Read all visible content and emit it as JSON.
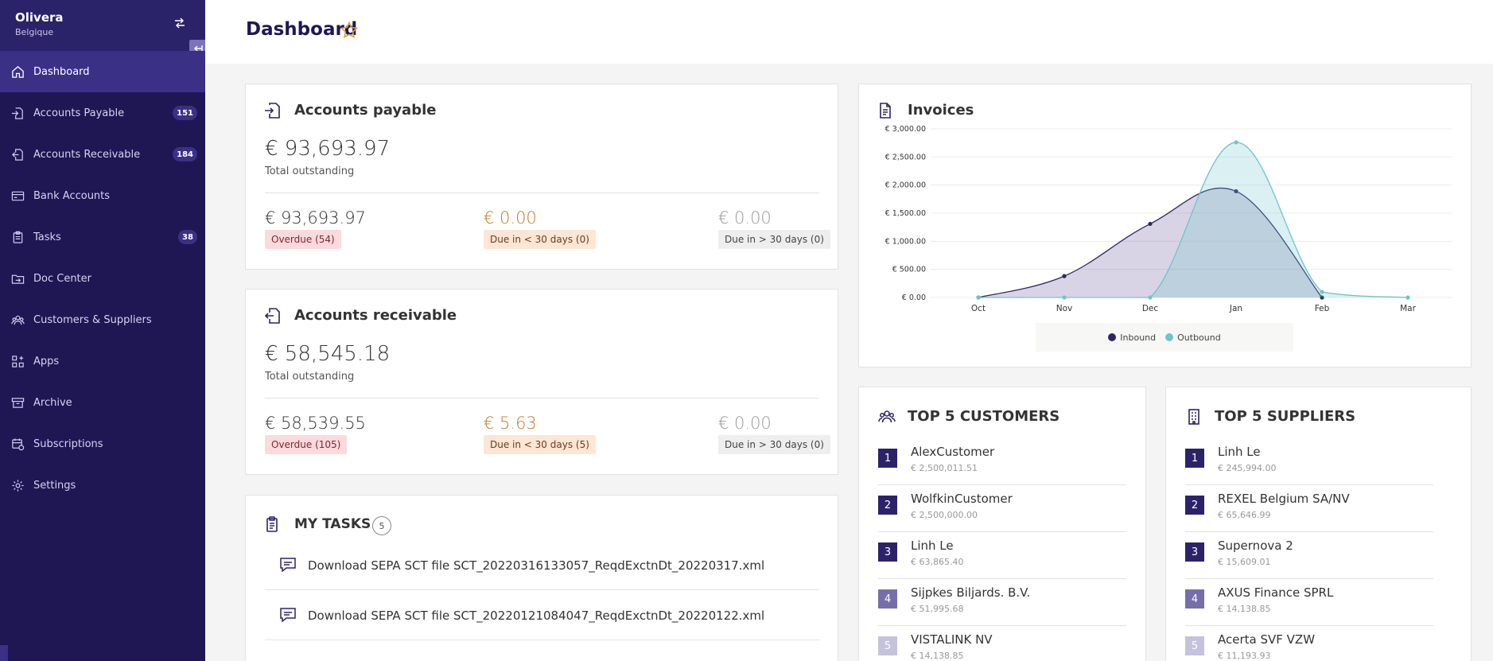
{
  "sidebar": {
    "org_name": "Olivera",
    "org_country": "Belgique",
    "items": [
      {
        "label": "Dashboard",
        "icon": "home-icon",
        "badge": null,
        "active": true
      },
      {
        "label": "Accounts Payable",
        "icon": "inbound-doc-icon",
        "badge": "151"
      },
      {
        "label": "Accounts Receivable",
        "icon": "outbound-doc-icon",
        "badge": "184"
      },
      {
        "label": "Bank Accounts",
        "icon": "bank-card-icon",
        "badge": null
      },
      {
        "label": "Tasks",
        "icon": "clipboard-icon",
        "badge": "38"
      },
      {
        "label": "Doc Center",
        "icon": "folder-sync-icon",
        "badge": null
      },
      {
        "label": "Customers & Suppliers",
        "icon": "users-icon",
        "badge": null
      },
      {
        "label": "Apps",
        "icon": "apps-grid-icon",
        "badge": null
      },
      {
        "label": "Archive",
        "icon": "archive-box-icon",
        "badge": null
      },
      {
        "label": "Subscriptions",
        "icon": "calendar-sync-icon",
        "badge": null
      },
      {
        "label": "Settings",
        "icon": "gear-icon",
        "badge": null
      }
    ]
  },
  "header": {
    "title": "Dashboard"
  },
  "payable": {
    "title": "Accounts payable",
    "total": "€ 93,693.97",
    "total_caption": "Total outstanding",
    "overdue_amount": "€ 93,693.97",
    "overdue_label": "Overdue (54)",
    "due_lt_amount": "€ 0.00",
    "due_lt_label": "Due in < 30 days (0)",
    "due_gt_amount": "€ 0.00",
    "due_gt_label": "Due in > 30 days (0)"
  },
  "receivable": {
    "title": "Accounts receivable",
    "total": "€ 58,545.18",
    "total_caption": "Total outstanding",
    "overdue_amount": "€ 58,539.55",
    "overdue_label": "Overdue (105)",
    "due_lt_amount": "€ 5.63",
    "due_lt_label": "Due in < 30 days (5)",
    "due_gt_amount": "€ 0.00",
    "due_gt_label": "Due in > 30 days (0)"
  },
  "tasks": {
    "title": "MY TASKS",
    "count": "5",
    "items": [
      "Download SEPA SCT file SCT_20220316133057_ReqdExctnDt_20220317.xml",
      "Download SEPA SCT file SCT_20220121084047_ReqdExctnDt_20220122.xml"
    ]
  },
  "invoices": {
    "title": "Invoices"
  },
  "chart_data": {
    "type": "area",
    "title": "Invoices",
    "categories": [
      "Oct",
      "Nov",
      "Dec",
      "Jan",
      "Feb",
      "Mar"
    ],
    "y_ticks": [
      "€ 0.00",
      "€ 500.00",
      "€ 1,000.00",
      "€ 1,500.00",
      "€ 2,000.00",
      "€ 2,500.00",
      "€ 3,000.00"
    ],
    "ylim": [
      0,
      3000
    ],
    "series": [
      {
        "name": "Inbound",
        "color": "#2c2866",
        "values": [
          0,
          380,
          1310,
          1890,
          0,
          null
        ]
      },
      {
        "name": "Outbound",
        "color": "#6cc5cc",
        "values": [
          0,
          0,
          0,
          2760,
          100,
          0
        ]
      }
    ],
    "grid": true,
    "legend": "bottom-center"
  },
  "customers": {
    "title": "TOP 5 CUSTOMERS",
    "items": [
      {
        "rank": "1",
        "name": "AlexCustomer",
        "value": "€ 2,500,011.51"
      },
      {
        "rank": "2",
        "name": "WolfkinCustomer",
        "value": "€ 2,500,000.00"
      },
      {
        "rank": "3",
        "name": "Linh Le",
        "value": "€ 63,865.40"
      },
      {
        "rank": "4",
        "name": "Sijpkes Biljards. B.V.",
        "value": "€ 51,995.68"
      },
      {
        "rank": "5",
        "name": "VISTALINK NV",
        "value": "€ 14,138.85"
      }
    ]
  },
  "suppliers": {
    "title": "TOP 5 SUPPLIERS",
    "items": [
      {
        "rank": "1",
        "name": "Linh Le",
        "value": "€ 245,994.00"
      },
      {
        "rank": "2",
        "name": "REXEL Belgium SA/NV",
        "value": "€ 65,646.99"
      },
      {
        "rank": "3",
        "name": "Supernova 2",
        "value": "€ 15,609.01"
      },
      {
        "rank": "4",
        "name": "AXUS Finance SPRL",
        "value": "€ 14,138.85"
      },
      {
        "rank": "5",
        "name": "Acerta SVF VZW",
        "value": "€ 11,193.93"
      }
    ]
  },
  "colors": {
    "sidebar_bg": "#1f1754",
    "accent": "#3a3186",
    "rank_1_3": "#2b2369",
    "rank_4": "#756fa8",
    "rank_5": "#c5c2dc"
  }
}
